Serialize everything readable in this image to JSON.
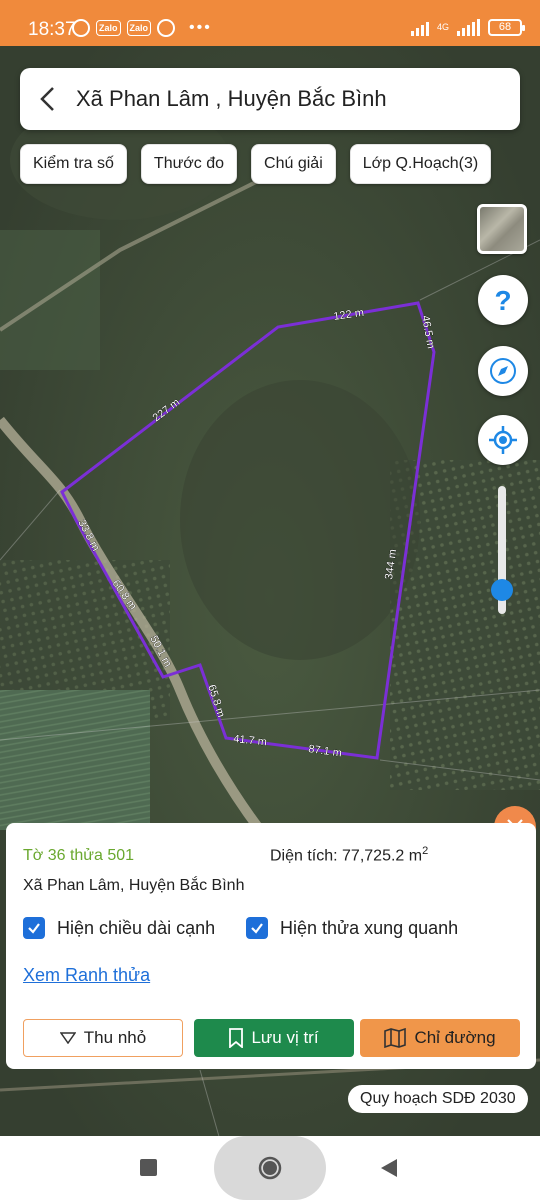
{
  "status": {
    "time": "18:37",
    "battery": "68",
    "network": "4G"
  },
  "search": {
    "title": "Xã Phan Lâm , Huyện Bắc Bình"
  },
  "chips": [
    {
      "label": "Kiểm tra số"
    },
    {
      "label": "Thước đo"
    },
    {
      "label": "Chú giải"
    },
    {
      "label": "Lớp Q.Hoạch(3)"
    }
  ],
  "map": {
    "boundary_color": "#7b2fd6",
    "edge_labels": [
      "122 m",
      "46.5 m",
      "227 m",
      "344 m",
      "33.8 m",
      "60.8 m",
      "50.1 m",
      "65.8 m",
      "41.7 m",
      "87.1 m"
    ]
  },
  "zoom": {
    "level": 0.2
  },
  "parcel": {
    "id": "Tờ 36 thửa 501",
    "area_label": "Diện tích: 77,725.2 m",
    "area_sup": "2",
    "address": "Xã Phan Lâm, Huyện Bắc Bình",
    "show_edge_lengths": "Hiện chiều dài cạnh",
    "show_neighbors": "Hiện thửa xung quanh",
    "view_boundary": "Xem Ranh thửa"
  },
  "actions": {
    "minimize": "Thu nhỏ",
    "save_location": "Lưu vị trí",
    "directions": "Chỉ đường"
  },
  "plan_badge": "Quy hoạch SDĐ 2030",
  "colors": {
    "accent": "#f08a3c",
    "green": "#1e8a4c",
    "blue": "#1e6fd9"
  }
}
